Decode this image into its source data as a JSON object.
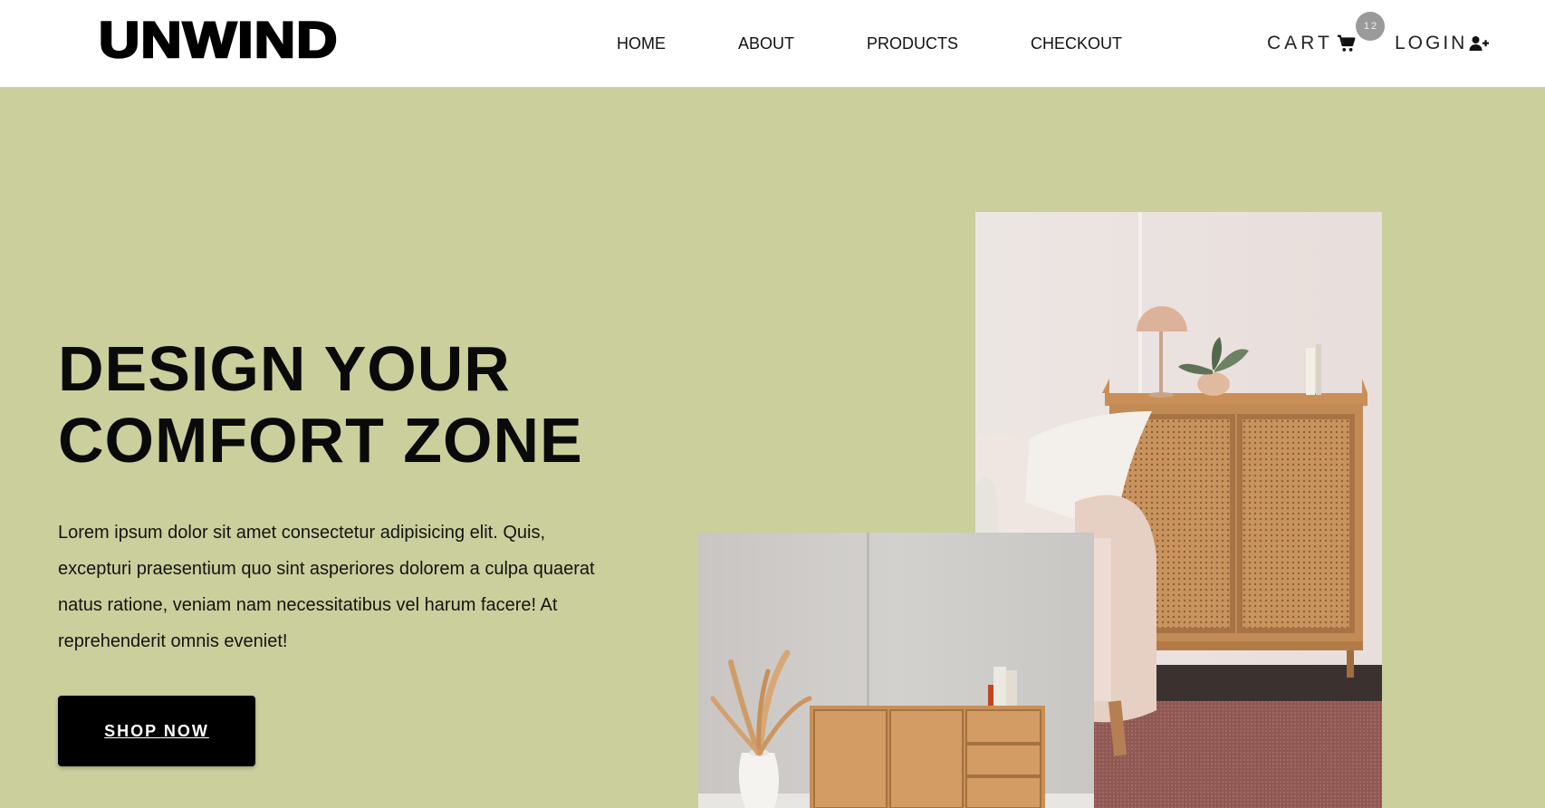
{
  "brand": {
    "logo_text": "UNWIND"
  },
  "nav": {
    "home": "HOME",
    "about": "ABOUT",
    "products": "PRODUCTS",
    "checkout": "CHECKOUT"
  },
  "cart": {
    "label": "CART",
    "count": "12",
    "icon": "cart-icon"
  },
  "login": {
    "label": "LOGIN",
    "icon": "user-plus-icon"
  },
  "hero": {
    "title_line1": "DESIGN YOUR",
    "title_line2": "COMFORT ZONE",
    "description": "Lorem ipsum dolor sit amet consectetur adipisicing elit. Quis, excepturi praesentium quo sint asperiores dolorem a culpa quaerat natus ratione, veniam nam necessitatibus vel harum facere! At reprehenderit omnis eveniet!",
    "cta_label": "SHOP NOW"
  },
  "colors": {
    "hero_background": "#cbcf9c",
    "header_background": "#ffffff",
    "button_background": "#000000",
    "badge_background": "#9a9a9a"
  }
}
